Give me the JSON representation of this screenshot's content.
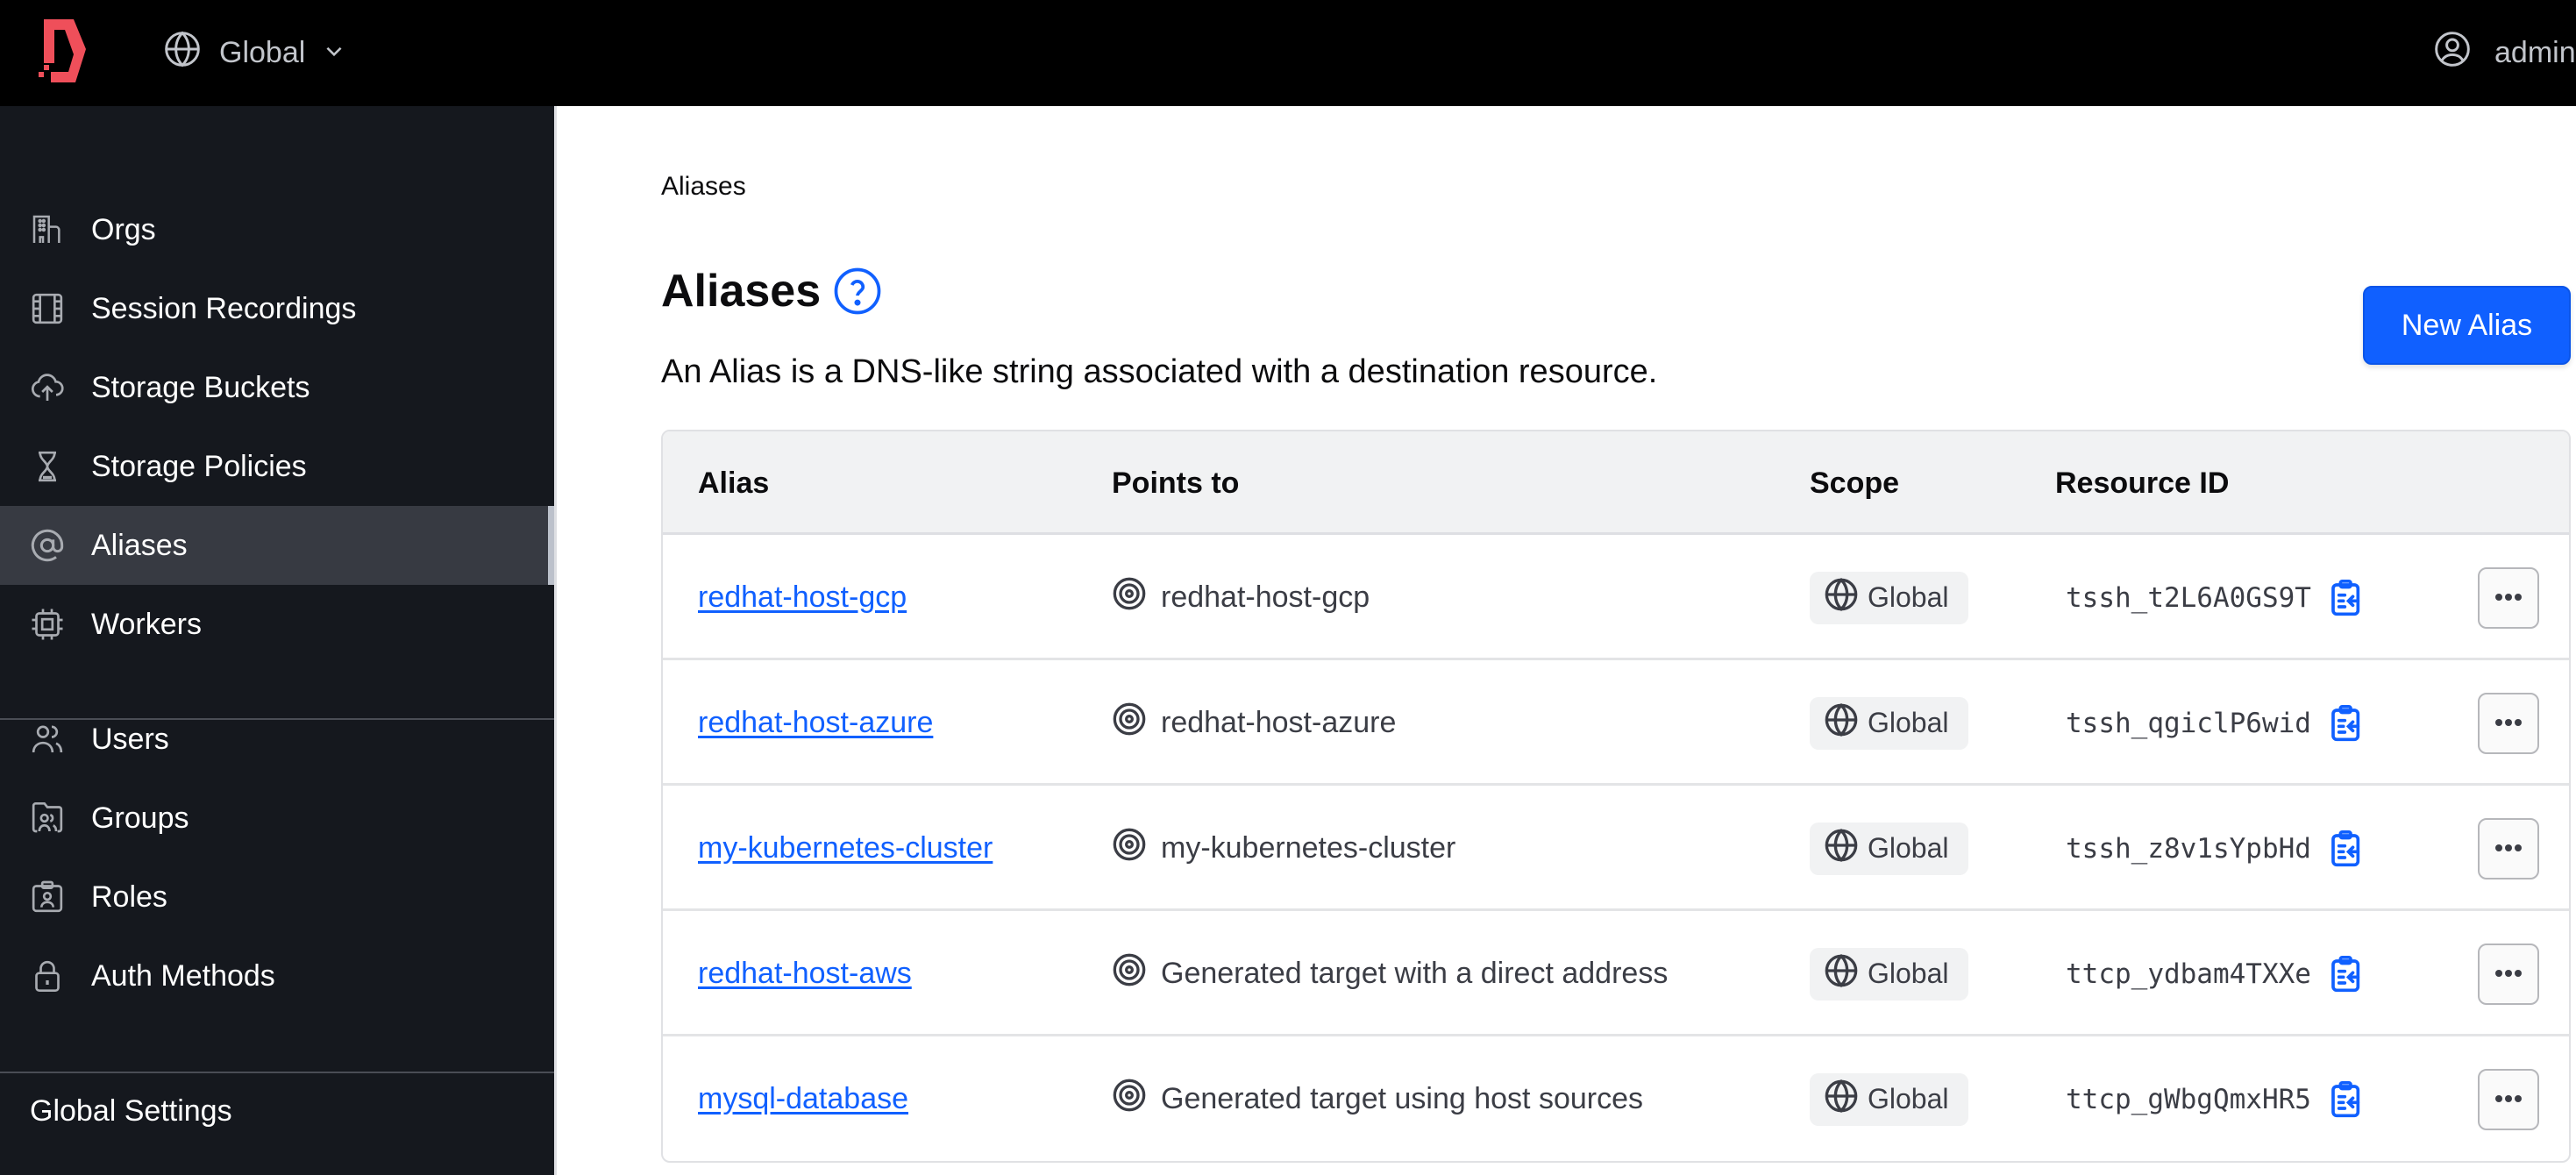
{
  "topbar": {
    "scope_label": "Global",
    "user_label": "admin"
  },
  "sidebar": {
    "items": [
      {
        "label": "Orgs",
        "icon": "building-icon"
      },
      {
        "label": "Session Recordings",
        "icon": "film-icon"
      },
      {
        "label": "Storage Buckets",
        "icon": "cloud-upload-icon"
      },
      {
        "label": "Storage Policies",
        "icon": "hourglass-icon"
      },
      {
        "label": "Aliases",
        "icon": "at-sign-icon",
        "active": true
      },
      {
        "label": "Workers",
        "icon": "cpu-chip-icon"
      },
      {
        "label": "Users",
        "icon": "users-icon"
      },
      {
        "label": "Groups",
        "icon": "group-folder-icon"
      },
      {
        "label": "Roles",
        "icon": "id-badge-icon"
      },
      {
        "label": "Auth Methods",
        "icon": "lock-icon"
      }
    ],
    "settings_label": "Global Settings"
  },
  "main": {
    "breadcrumb": "Aliases",
    "title": "Aliases",
    "description": "An Alias is a DNS-like string associated with a destination resource.",
    "new_button_label": "New Alias",
    "table": {
      "columns": [
        "Alias",
        "Points to",
        "Scope",
        "Resource ID"
      ],
      "rows": [
        {
          "alias": "redhat-host-gcp",
          "points_to": "redhat-host-gcp",
          "scope": "Global",
          "resource_id": "tssh_t2L6A0GS9T"
        },
        {
          "alias": "redhat-host-azure",
          "points_to": "redhat-host-azure",
          "scope": "Global",
          "resource_id": "tssh_qgiclP6wid"
        },
        {
          "alias": "my-kubernetes-cluster",
          "points_to": "my-kubernetes-cluster",
          "scope": "Global",
          "resource_id": "tssh_z8v1sYpbHd"
        },
        {
          "alias": "redhat-host-aws",
          "points_to": "Generated target with a direct address",
          "scope": "Global",
          "resource_id": "ttcp_ydbam4TXXe"
        },
        {
          "alias": "mysql-database",
          "points_to": "Generated target using host sources",
          "scope": "Global",
          "resource_id": "ttcp_gWbgQmxHR5"
        }
      ]
    }
  },
  "colors": {
    "brand": "#ef4f5a",
    "accent": "#1060ff",
    "sidebar_bg": "#15181e",
    "sidebar_active": "#373a42"
  }
}
